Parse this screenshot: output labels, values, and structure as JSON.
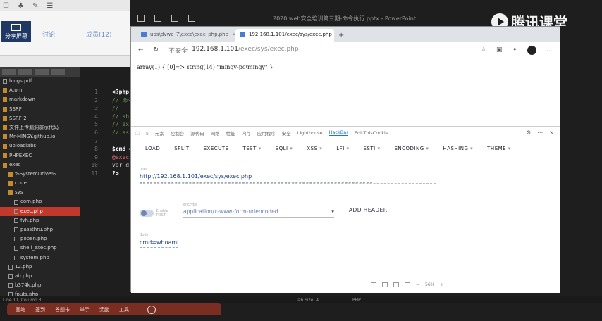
{
  "share": {
    "topbar_icons": [
      "☐",
      "♣",
      "✎",
      "☰"
    ],
    "button_label": "分享屏幕",
    "tabs": [
      "讨论",
      "成员(12)"
    ]
  },
  "sidebar": {
    "items": [
      {
        "label": "blogs.pdf",
        "type": "file",
        "indent": 0
      },
      {
        "label": "Atom",
        "type": "folder",
        "indent": 0
      },
      {
        "label": "markdown",
        "type": "folder",
        "indent": 0
      },
      {
        "label": "SSRF",
        "type": "folder",
        "indent": 0
      },
      {
        "label": "SSRF-2",
        "type": "folder",
        "indent": 0
      },
      {
        "label": "文件上传漏洞演示代码",
        "type": "folder",
        "indent": 0
      },
      {
        "label": "Mr-MINGY.github.io",
        "type": "folder",
        "indent": 0
      },
      {
        "label": "uploadlabs",
        "type": "folder",
        "indent": 0
      },
      {
        "label": "PHPEXEC",
        "type": "folder",
        "indent": 0
      },
      {
        "label": "exec",
        "type": "folder",
        "indent": 0
      },
      {
        "label": "%SystemDrive%",
        "type": "folder",
        "indent": 1
      },
      {
        "label": "code",
        "type": "folder",
        "indent": 1
      },
      {
        "label": "sys",
        "type": "folder",
        "indent": 1
      },
      {
        "label": "com.php",
        "type": "file",
        "indent": 2
      },
      {
        "label": "exec.php",
        "type": "file",
        "indent": 2,
        "selected": true
      },
      {
        "label": "fyh.php",
        "type": "file",
        "indent": 2
      },
      {
        "label": "passthru.php",
        "type": "file",
        "indent": 2
      },
      {
        "label": "popen.php",
        "type": "file",
        "indent": 2
      },
      {
        "label": "shell_exec.php",
        "type": "file",
        "indent": 2
      },
      {
        "label": "system.php",
        "type": "file",
        "indent": 2
      },
      {
        "label": "12.php",
        "type": "file",
        "indent": 1
      },
      {
        "label": "ab.php",
        "type": "file",
        "indent": 1
      },
      {
        "label": "b374k.php",
        "type": "file",
        "indent": 1
      },
      {
        "label": "fputs.php",
        "type": "file",
        "indent": 1
      },
      {
        "label": "phpab.php",
        "type": "file",
        "indent": 1
      }
    ]
  },
  "editor": {
    "line_numbers": [
      "1",
      "2",
      "3",
      "4",
      "5",
      "6",
      "7",
      "8",
      "9",
      "10",
      "11"
    ],
    "lines": [
      {
        "text": "<?php",
        "cls": "st"
      },
      {
        "text": "// 命令",
        "cls": "cm"
      },
      {
        "text": "//",
        "cls": "cm"
      },
      {
        "text": "// sh",
        "cls": "cm"
      },
      {
        "text": "// ex",
        "cls": "cm"
      },
      {
        "text": "// ss",
        "cls": "cm"
      },
      {
        "text": "",
        "cls": ""
      },
      {
        "text": "$cmd =",
        "cls": "st"
      },
      {
        "text": "@exec",
        "cls": "kw"
      },
      {
        "text": "var_d",
        "cls": ""
      },
      {
        "text": "?>",
        "cls": "st"
      }
    ]
  },
  "statusbar": {
    "position": "Line 11, Column 3",
    "tab_size": "Tab Size: 4",
    "language": "PHP"
  },
  "taskbar": {
    "items": [
      "画笔",
      "签到",
      "答题卡",
      "举手",
      "奖励",
      "工具"
    ]
  },
  "powerpoint": {
    "title": "2020 web安全培训第三期-命令执行.pptx - PowerPoint"
  },
  "brand": {
    "name": "腾讯课堂"
  },
  "browser": {
    "tabs": [
      {
        "title": "ubs\\dvwa_7\\exec\\exec_php.php",
        "active": false
      },
      {
        "title": "192.168.1.101/exec/sys/exec.php",
        "active": true
      }
    ],
    "new_tab": "+",
    "address": {
      "security": "不安全",
      "url_host": "192.168.1.101",
      "url_path": "/exec/sys/exec.php"
    },
    "page_output": "array(1) { [0]=> string(14) \"mingy-pc\\mingy\" }"
  },
  "devtools": {
    "tabs": [
      "元素",
      "控制台",
      "源代码",
      "网络",
      "性能",
      "内存",
      "应用程序",
      "安全",
      "Lighthouse",
      "HackBar",
      "EditThisCookie"
    ],
    "active_tab": "HackBar",
    "hackbar_menu": [
      {
        "label": "LOAD",
        "dropdown": false
      },
      {
        "label": "SPLIT",
        "dropdown": false
      },
      {
        "label": "EXECUTE",
        "dropdown": false
      },
      {
        "label": "TEST",
        "dropdown": true
      },
      {
        "label": "SQLI",
        "dropdown": true
      },
      {
        "label": "XSS",
        "dropdown": true
      },
      {
        "label": "LFI",
        "dropdown": true
      },
      {
        "label": "SSTI",
        "dropdown": true
      },
      {
        "label": "ENCODING",
        "dropdown": true
      },
      {
        "label": "HASHING",
        "dropdown": true
      },
      {
        "label": "THEME",
        "dropdown": true
      }
    ],
    "url_label": "URL",
    "url_value": "http://192.168.1.101/exec/sys/exec.php",
    "post_label": "Enable POST",
    "enctype_label": "enctype",
    "enctype_value": "application/x-www-form-urlencoded",
    "add_header": "ADD HEADER",
    "body_label": "Body",
    "body_value": "cmd=whoami",
    "zoom": "56%"
  }
}
